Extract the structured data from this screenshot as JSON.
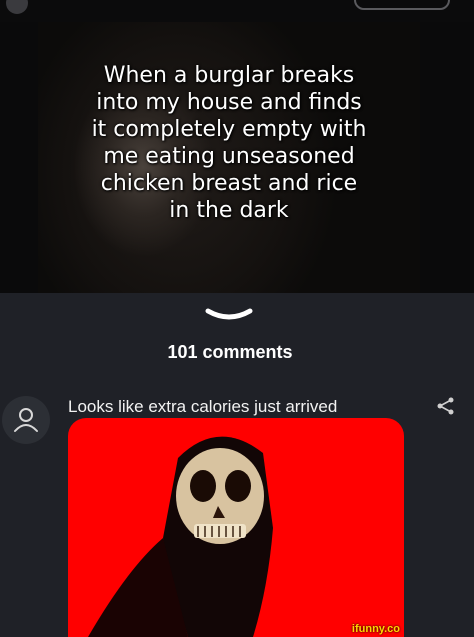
{
  "post": {
    "caption_lines": [
      "When a burglar breaks",
      "into my house and finds",
      "it completely empty with",
      "me eating unseasoned",
      "chicken breast and rice",
      "in the dark"
    ]
  },
  "comments_section": {
    "count_label": "101 comments"
  },
  "comment": {
    "text": "Looks like extra calories just arrived"
  },
  "watermark": "ifunny.co",
  "icons": {
    "collapse": "chevron-down-icon",
    "avatar": "user-icon",
    "share": "share-icon"
  },
  "colors": {
    "background": "#1f2127",
    "comment_image_bg": "#ff0000",
    "watermark": "#ffd400"
  }
}
